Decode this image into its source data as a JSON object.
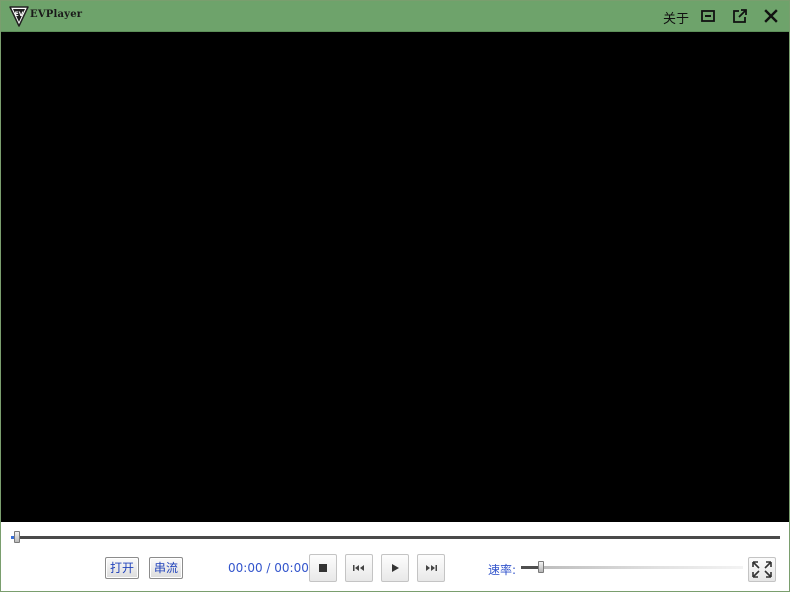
{
  "window": {
    "title": "EVPlayer",
    "about_label": "关于",
    "logo_text": "EV"
  },
  "colors": {
    "titlebar": "#6ea36b",
    "video_bg": "#000000",
    "accent_text": "#3355cc"
  },
  "titlebar_icons": [
    "mini-mode-icon",
    "popout-icon",
    "close-icon"
  ],
  "controls": {
    "open_label": "打开",
    "stream_label": "串流",
    "time_text": "00:00 / 00:00",
    "speed_label": "速率:",
    "progress_fraction": 0.008,
    "speed_fraction": 0.09,
    "icons": [
      "stop-icon",
      "previous-icon",
      "play-icon",
      "next-icon",
      "fullscreen-icon"
    ]
  }
}
